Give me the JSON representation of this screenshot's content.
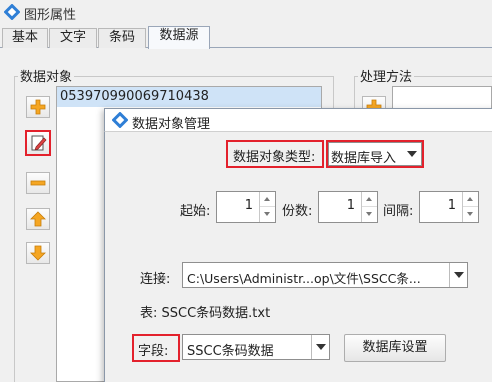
{
  "window": {
    "title": "图形属性"
  },
  "tabs": [
    {
      "label": "基本"
    },
    {
      "label": "文字"
    },
    {
      "label": "条码"
    },
    {
      "label": "数据源"
    }
  ],
  "data_objects": {
    "group_label": "数据对象",
    "items": [
      "053970990069710438"
    ],
    "side_buttons": [
      {
        "icon": "add-icon"
      },
      {
        "icon": "edit-icon"
      },
      {
        "icon": "remove-icon"
      },
      {
        "icon": "move-up-icon"
      },
      {
        "icon": "move-down-icon"
      }
    ]
  },
  "processing": {
    "group_label": "处理方法"
  },
  "dialog": {
    "title": "数据对象管理",
    "type_label": "数据对象类型:",
    "type_value": "数据库导入",
    "start_label": "起始:",
    "start_value": "1",
    "count_label": "份数:",
    "count_value": "1",
    "interval_label": "间隔:",
    "interval_value": "1",
    "connection_label": "连接:",
    "connection_value": "C:\\Users\\Administr...op\\文件\\SSCC条...",
    "table_label": "表: SSCC条码数据.txt",
    "field_label": "字段:",
    "field_value": "SSCC条码数据",
    "db_settings_button": "数据库设置"
  },
  "colors": {
    "highlight": "#e3212c",
    "selection": "#cfe3f7",
    "icon_orange": "#f5a623"
  }
}
